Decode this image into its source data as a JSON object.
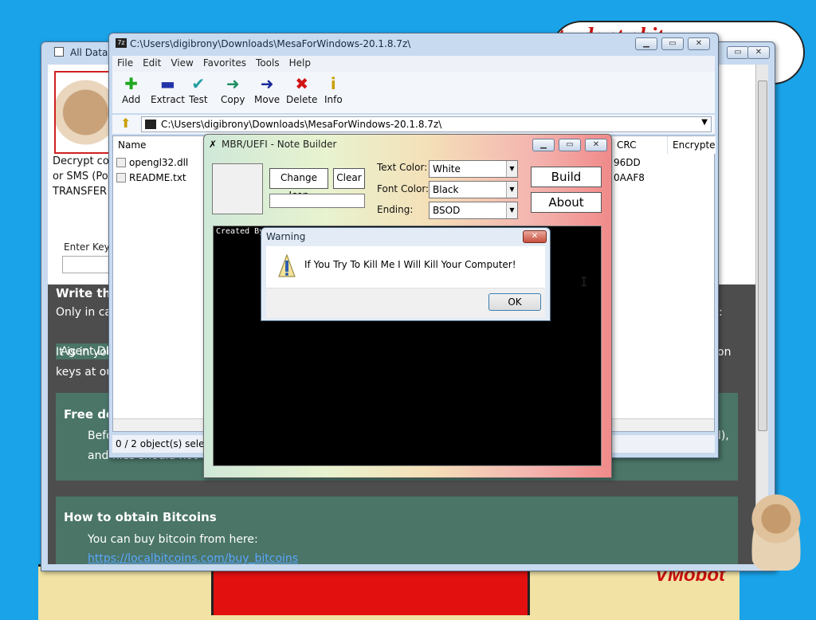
{
  "wallpaper": {
    "cloud_text": "tu dont obit",
    "corner_text": "VMobot"
  },
  "ransom": {
    "title": "All Data E",
    "lines": [
      "Decrypt cos",
      "or SMS (Po",
      "TRANSFER"
    ],
    "key_label": "Enter Key",
    "right_bold": "ou",
    "write_heading": "Write thi",
    "only_line": "Only in ca",
    "only_line_end": ":",
    "tag": "Agent.DM",
    "is_in_line": "It is in you",
    "is_in_line_end": "on",
    "keys_line": "keys at ou",
    "free_heading": "Free de",
    "free_p1": "Befo",
    "free_p1_end": "d),",
    "free_p2": "and files should not ce",
    "obtain_heading": "How to obtain Bitcoins",
    "obtain_p": "You can buy bitcoin from here:",
    "obtain_link": "https://localbitcoins.com/buy_bitcoins"
  },
  "zip": {
    "title": "C:\\Users\\digibrony\\Downloads\\MesaForWindows-20.1.8.7z\\",
    "menu": [
      "File",
      "Edit",
      "View",
      "Favorites",
      "Tools",
      "Help"
    ],
    "tools": [
      {
        "label": "Add",
        "icon": "plus-icon",
        "glyph": "✚",
        "color": "#1fa81f"
      },
      {
        "label": "Extract",
        "icon": "minus-icon",
        "glyph": "▬",
        "color": "#2233aa"
      },
      {
        "label": "Test",
        "icon": "check-icon",
        "glyph": "✔",
        "color": "#20a0a0"
      },
      {
        "label": "Copy",
        "icon": "copy-arrow-icon",
        "glyph": "➜",
        "color": "#1f8f5f"
      },
      {
        "label": "Move",
        "icon": "move-arrow-icon",
        "glyph": "➜",
        "color": "#1c2a9a"
      },
      {
        "label": "Delete",
        "icon": "delete-x-icon",
        "glyph": "✖",
        "color": "#d01515"
      },
      {
        "label": "Info",
        "icon": "info-icon",
        "glyph": "i",
        "color": "#c9a000"
      }
    ],
    "address": "C:\\Users\\digibrony\\Downloads\\MesaForWindows-20.1.8.7z\\",
    "columns": {
      "name": "Name",
      "crc": "CRC",
      "encrypted": "Encrypte"
    },
    "files": [
      {
        "name": "opengl32.dll",
        "crc": "96DD"
      },
      {
        "name": "README.txt",
        "crc": "0AAF8"
      }
    ],
    "status": "0 / 2 object(s) selecte"
  },
  "notebuilder": {
    "title": "MBR/UEFI - Note Builder",
    "change_icon": "Change Icon",
    "clear": "Clear",
    "text_color_label": "Text Color:",
    "text_color": "White",
    "font_color_label": "Font Color:",
    "font_color": "Black",
    "ending_label": "Ending:",
    "ending": "BSOD",
    "build": "Build",
    "about": "About",
    "console_text": "Created By"
  },
  "warning": {
    "title": "Warning",
    "message": "If You Try To Kill Me I Will Kill Your Computer!",
    "ok": "OK"
  }
}
